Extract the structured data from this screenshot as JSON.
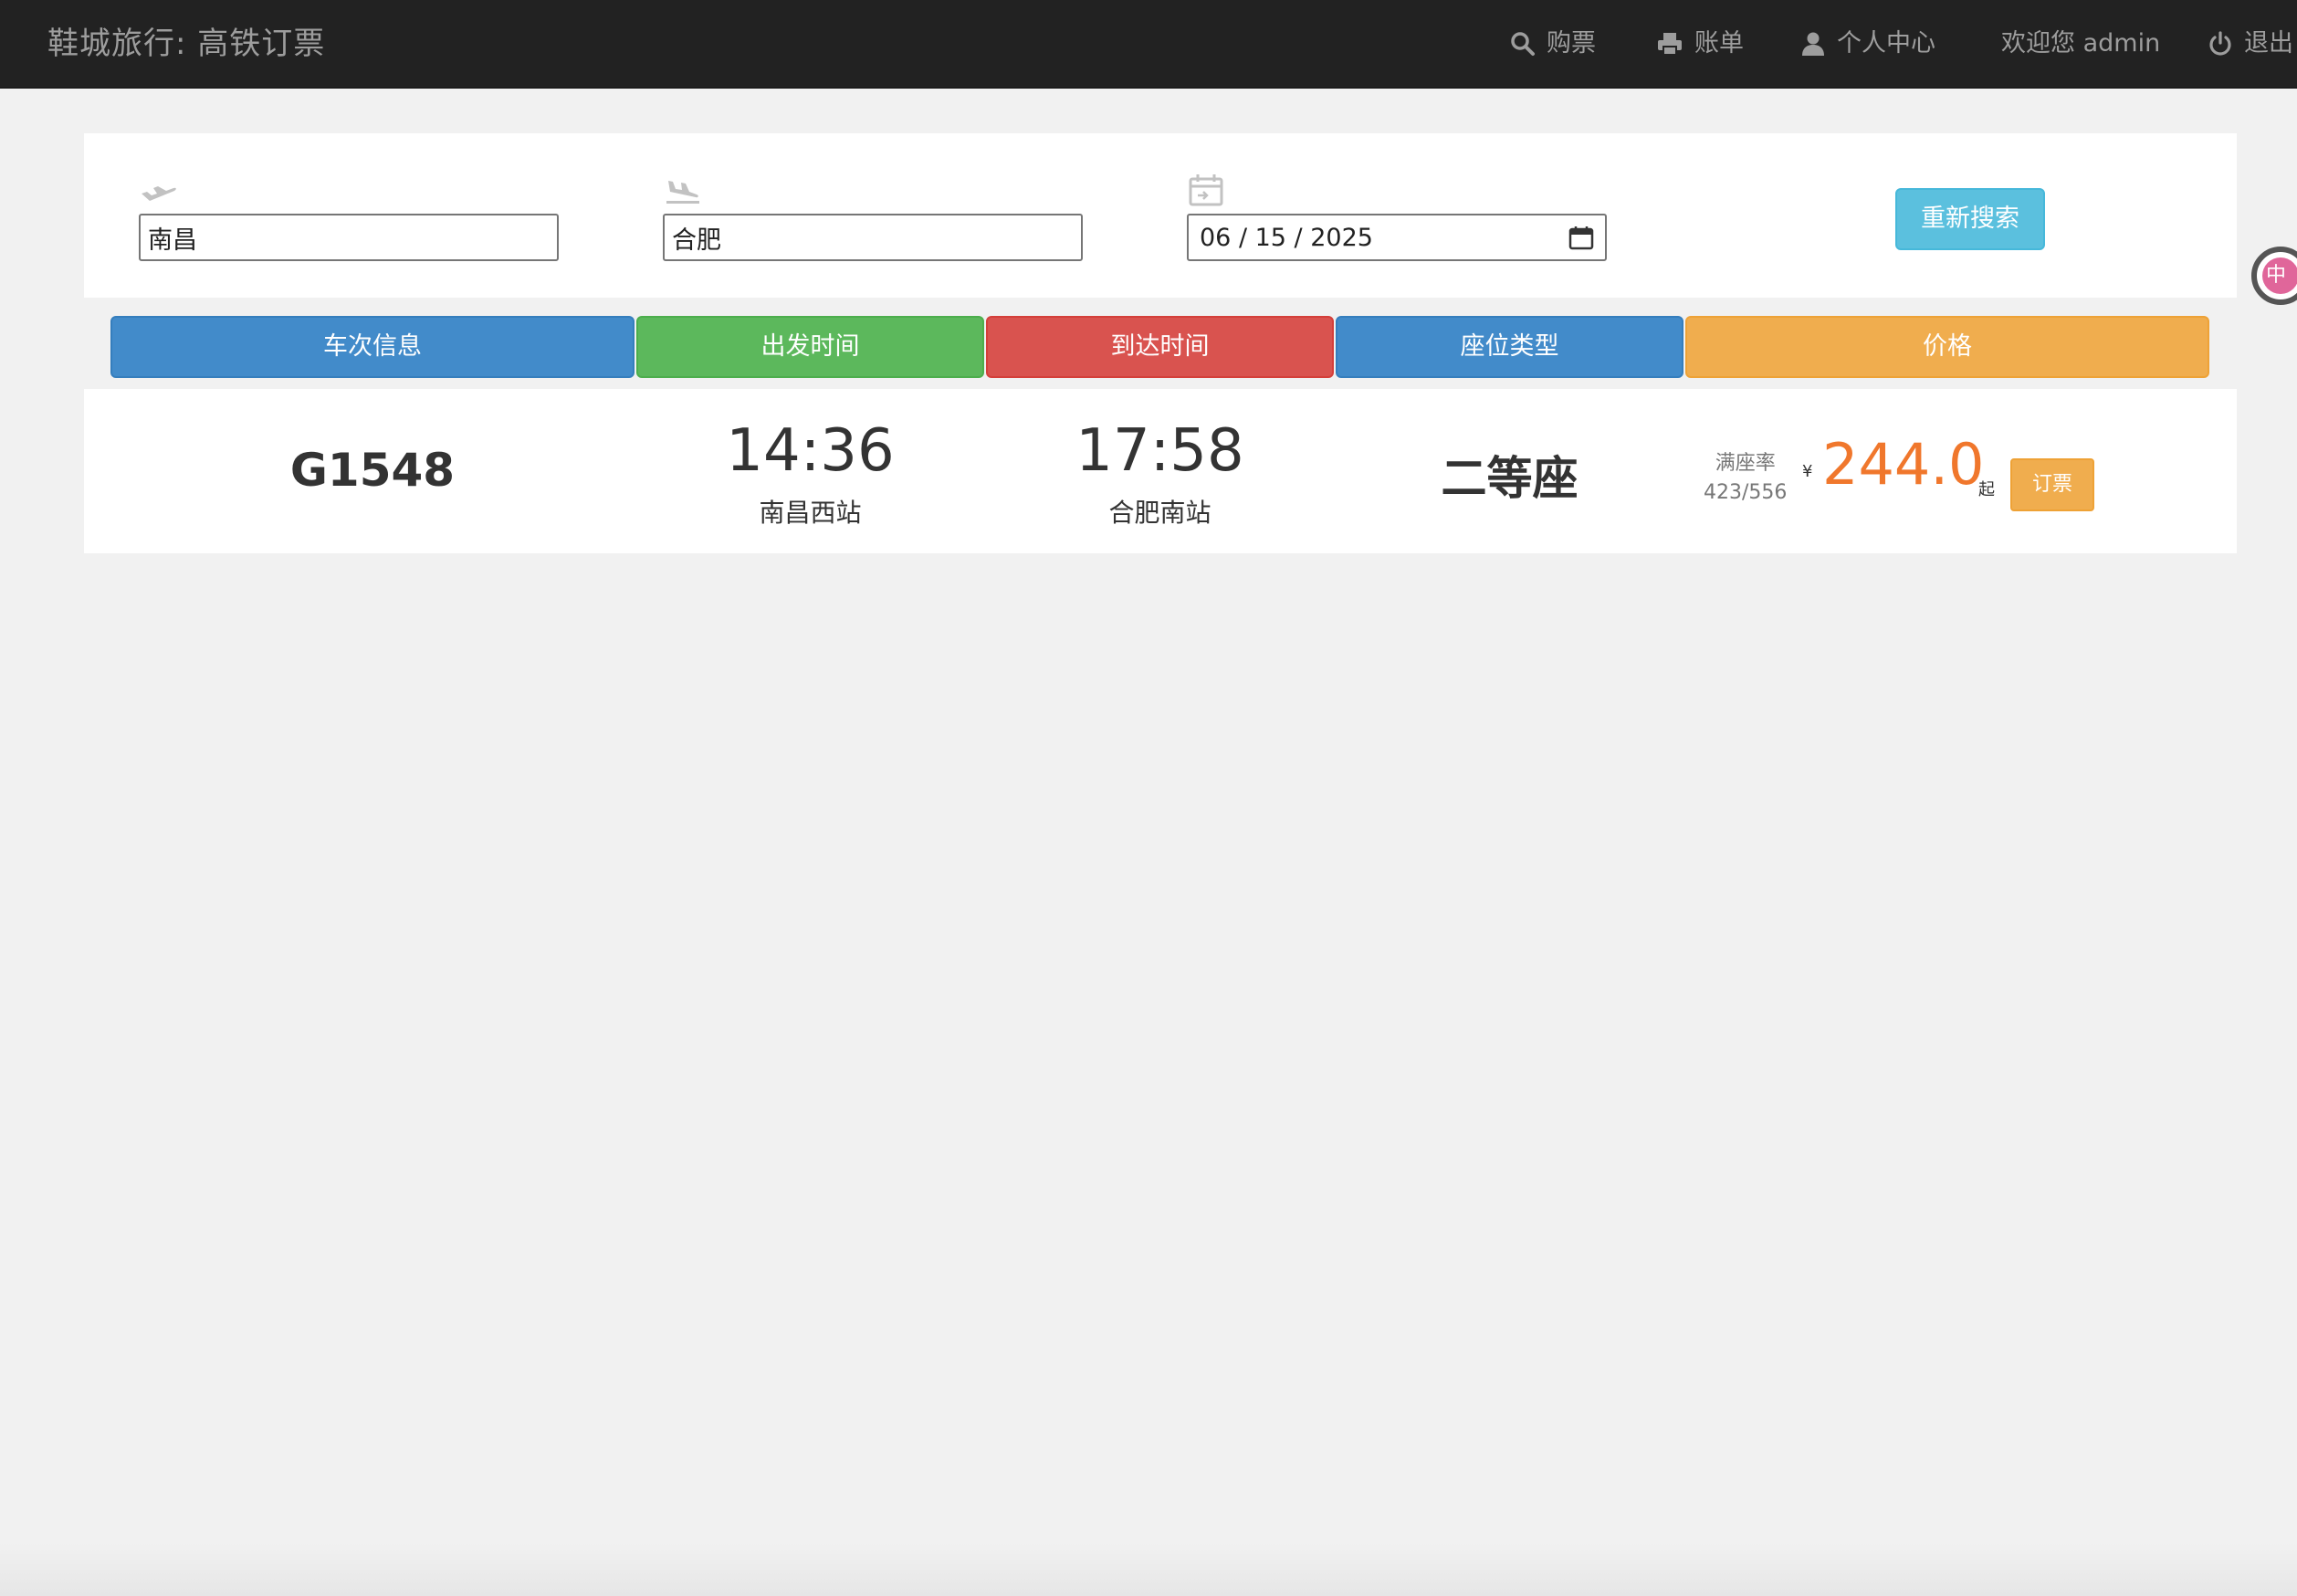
{
  "navbar": {
    "brand": "鞋城旅行: 高铁订票",
    "buy": "购票",
    "bill": "账单",
    "profile": "个人中心",
    "welcome": "欢迎您 admin",
    "logout": "退出"
  },
  "search": {
    "from_value": "南昌",
    "to_value": "合肥",
    "date_value": "06 / 15 / 2025",
    "research_label": "重新搜索"
  },
  "headers": {
    "train_info": "车次信息",
    "depart_time": "出发时间",
    "arrive_time": "到达时间",
    "seat_type": "座位类型",
    "price": "价格"
  },
  "results": [
    {
      "train_no": "G1548",
      "depart_time": "14:36",
      "depart_station": "南昌西站",
      "arrive_time": "17:58",
      "arrive_station": "合肥南站",
      "seat_type": "二等座",
      "occupancy_label": "满座率",
      "occupancy_value": "423/556",
      "currency": "¥",
      "price": "244.0",
      "price_suffix": "起",
      "book_label": "订票"
    }
  ],
  "side_widget": {
    "text": "中"
  },
  "colors": {
    "navbar_bg": "#222222",
    "primary": "#428bca",
    "success": "#5cb85c",
    "danger": "#d9534f",
    "warning": "#f0ad4e",
    "info": "#5bc0de",
    "price_orange": "#f0772c"
  },
  "icons": {
    "buy": "search-icon",
    "bill": "print-icon",
    "profile": "user-icon",
    "logout": "power-icon",
    "from": "plane-takeoff-icon",
    "to": "plane-landing-icon",
    "date": "calendar-icon"
  }
}
